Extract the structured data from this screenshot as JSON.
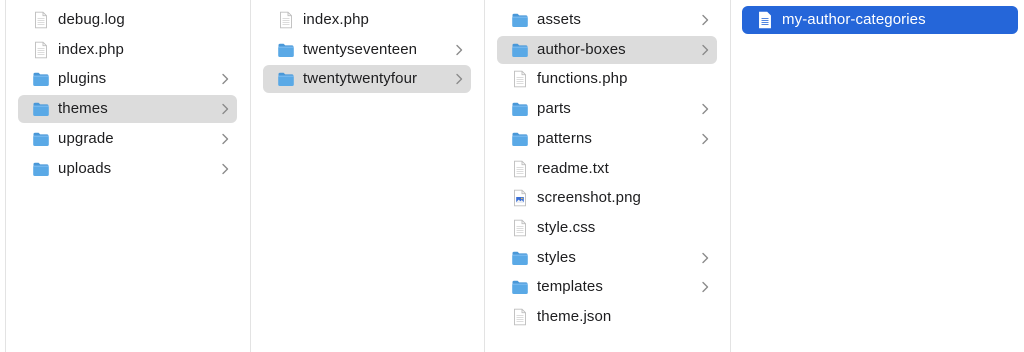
{
  "columns": [
    {
      "items": [
        {
          "name": "debug.log",
          "type": "file",
          "icon": "document-icon"
        },
        {
          "name": "index.php",
          "type": "file",
          "icon": "document-icon"
        },
        {
          "name": "plugins",
          "type": "folder",
          "icon": "folder-icon"
        },
        {
          "name": "themes",
          "type": "folder",
          "icon": "folder-icon",
          "selected": true
        },
        {
          "name": "upgrade",
          "type": "folder",
          "icon": "folder-icon"
        },
        {
          "name": "uploads",
          "type": "folder",
          "icon": "folder-icon"
        }
      ]
    },
    {
      "items": [
        {
          "name": "index.php",
          "type": "file",
          "icon": "document-icon"
        },
        {
          "name": "twentyseventeen",
          "type": "folder",
          "icon": "folder-icon"
        },
        {
          "name": "twentytwentyfour",
          "type": "folder",
          "icon": "folder-icon",
          "selected": true
        }
      ]
    },
    {
      "items": [
        {
          "name": "assets",
          "type": "folder",
          "icon": "folder-icon"
        },
        {
          "name": "author-boxes",
          "type": "folder",
          "icon": "folder-icon",
          "selected": true
        },
        {
          "name": "functions.php",
          "type": "file",
          "icon": "document-icon"
        },
        {
          "name": "parts",
          "type": "folder",
          "icon": "folder-icon"
        },
        {
          "name": "patterns",
          "type": "folder",
          "icon": "folder-icon"
        },
        {
          "name": "readme.txt",
          "type": "file",
          "icon": "document-icon"
        },
        {
          "name": "screenshot.png",
          "type": "file",
          "icon": "image-file-icon"
        },
        {
          "name": "style.css",
          "type": "file",
          "icon": "document-icon"
        },
        {
          "name": "styles",
          "type": "folder",
          "icon": "folder-icon"
        },
        {
          "name": "templates",
          "type": "folder",
          "icon": "folder-icon"
        },
        {
          "name": "theme.json",
          "type": "file",
          "icon": "document-icon"
        }
      ]
    },
    {
      "items": [
        {
          "name": "my-author-categories",
          "type": "file",
          "icon": "document-icon",
          "selected": true,
          "active": true
        }
      ]
    }
  ],
  "colors": {
    "folder": "#5aa9e6",
    "selection_active": "#2566d9",
    "selection_inactive": "#dcdcdc",
    "chevron": "#8a8a8a"
  }
}
